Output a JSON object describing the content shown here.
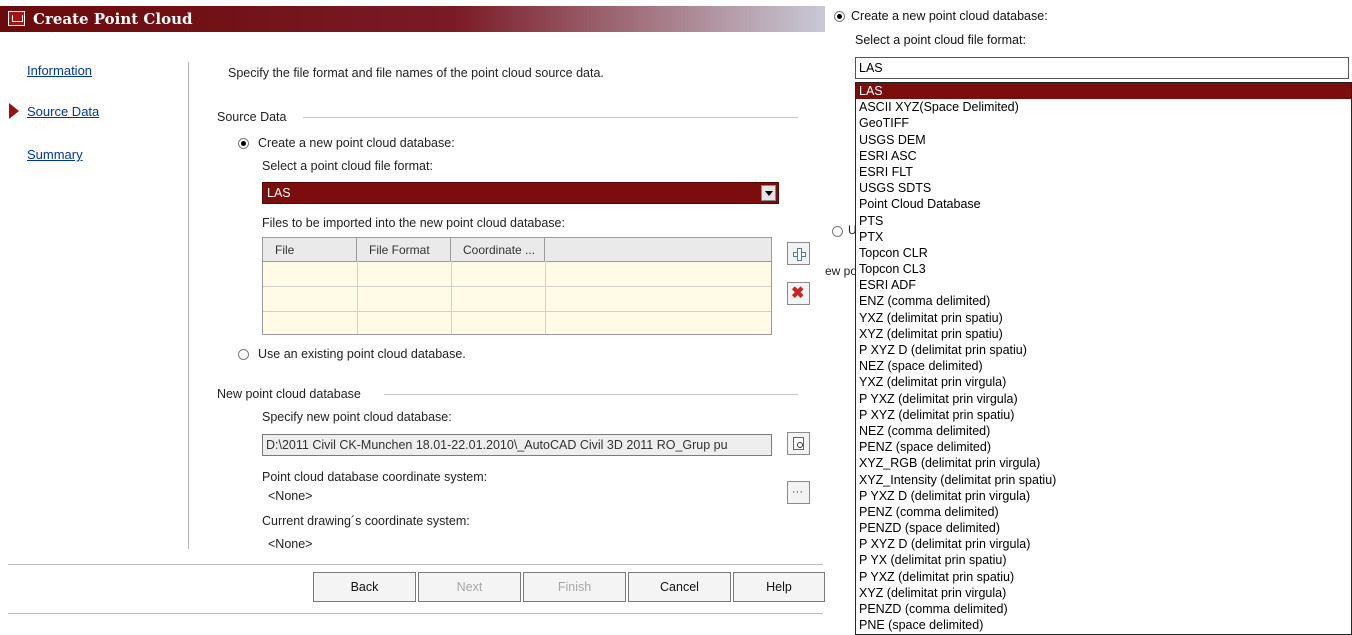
{
  "window": {
    "title": "Create Point Cloud"
  },
  "nav": {
    "items": [
      {
        "label": "Information"
      },
      {
        "label": "Source Data"
      },
      {
        "label": "Summary"
      }
    ]
  },
  "page": {
    "instruction": "Specify the file format and file names of the point cloud source data.",
    "source_group": "Source Data",
    "radio_new": "Create a new point cloud database:",
    "select_format_label": "Select a point cloud file format:",
    "format_value": "LAS",
    "files_label": "Files to be imported into the new point cloud database:",
    "table": {
      "columns": [
        "File",
        "File Format",
        "Coordinate ..."
      ]
    },
    "radio_existing": "Use an existing point cloud database.",
    "new_db_group": "New point cloud database",
    "specify_label": "Specify new point cloud database:",
    "db_path": "D:\\2011 Civil CK-Munchen 18.01-22.01.2010\\_AutoCAD Civil 3D 2011  RO_Grup pu",
    "db_cs_label": "Point cloud database coordinate system:",
    "db_cs_value": "<None>",
    "drawing_cs_label": "Current drawing´s coordinate system:",
    "drawing_cs_value": "<None>"
  },
  "buttons": {
    "back": "Back",
    "next": "Next",
    "finish": "Finish",
    "cancel": "Cancel",
    "help": "Help"
  },
  "dropdown": {
    "radio_label": "Create a new point cloud database:",
    "select_label": "Select a point cloud file format:",
    "value": "LAS",
    "partial_radio_text": "U",
    "partial_text": "ew po",
    "options": [
      "LAS",
      "ASCII XYZ(Space Delimited)",
      "GeoTIFF",
      "USGS DEM",
      "ESRI ASC",
      "ESRI FLT",
      "USGS SDTS",
      "Point Cloud Database",
      "PTS",
      "PTX",
      "Topcon CLR",
      "Topcon CL3",
      "ESRI ADF",
      "ENZ (comma delimited)",
      "YXZ (delimitat prin spatiu)",
      "XYZ (delimitat prin spatiu)",
      "P XYZ D (delimitat prin spatiu)",
      "NEZ (space delimited)",
      "YXZ (delimitat prin virgula)",
      "P YXZ (delimitat prin virgula)",
      "P XYZ (delimitat prin spatiu)",
      "NEZ (comma delimited)",
      "PENZ (space delimited)",
      "XYZ_RGB (delimitat prin virgula)",
      "XYZ_Intensity (delimitat prin spatiu)",
      "P YXZ D (delimitat prin virgula)",
      "PENZ (comma delimited)",
      "PENZD (space delimited)",
      "P XYZ D (delimitat prin virgula)",
      "P YX (delimitat prin spatiu)",
      "P YXZ (delimitat prin spatiu)",
      "XYZ (delimitat prin virgula)",
      "PENZD (comma delimited)",
      "PNE (space delimited)"
    ],
    "selected": "LAS"
  },
  "colors": {
    "accent": "#7b0d0d",
    "link": "#0033aa"
  }
}
